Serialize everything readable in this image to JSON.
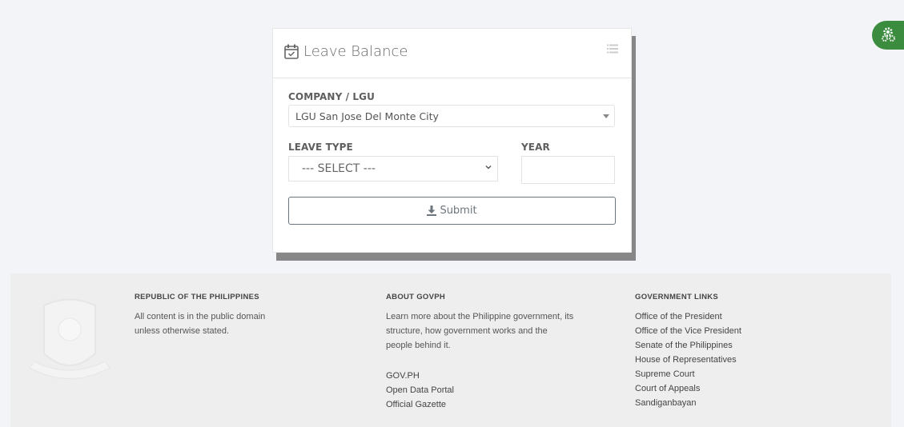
{
  "card": {
    "title": "Leave Balance",
    "company_label": "COMPANY / LGU",
    "company_value": "LGU San Jose Del Monte City",
    "leave_type_label": "LEAVE TYPE",
    "leave_type_value": "--- SELECT ---",
    "year_label": "YEAR",
    "year_value": "",
    "submit_label": "Submit"
  },
  "colors": {
    "settings_fab": "#3c8c40",
    "card_shadow": "#878787",
    "page_bg": "#f3f4f8",
    "footer_bg": "#eeeeee"
  },
  "footer": {
    "republic": {
      "heading": "REPUBLIC OF THE PHILIPPINES",
      "text_line1": "All content is in the public domain",
      "text_line2": "unless otherwise stated."
    },
    "about": {
      "heading": "ABOUT GOVPH",
      "text_line1": "Learn more about the Philippine government, its",
      "text_line2": "structure, how government works and the",
      "text_line3": "people behind it.",
      "links": [
        "GOV.PH",
        "Open Data Portal",
        "Official Gazette"
      ]
    },
    "gov_links": {
      "heading": "GOVERNMENT LINKS",
      "links": [
        "Office of the President",
        "Office of the Vice President",
        "Senate of the Philippines",
        "House of Representatives",
        "Supreme Court",
        "Court of Appeals",
        "Sandiganbayan"
      ]
    }
  }
}
